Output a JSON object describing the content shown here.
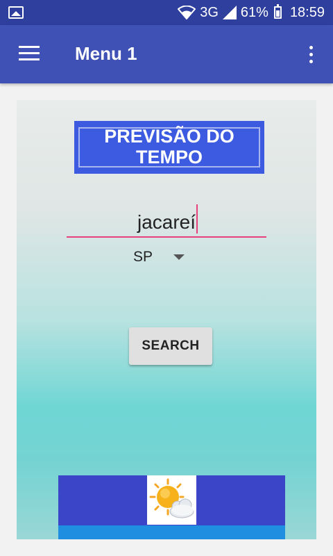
{
  "status_bar": {
    "network": "3G",
    "battery": "61%",
    "time": "18:59"
  },
  "app_bar": {
    "title": "Menu 1"
  },
  "main": {
    "heading": "PREVISÃO DO TEMPO",
    "city_input": {
      "value": "jacareí"
    },
    "state_select": {
      "selected": "SP"
    },
    "search_label": "SEARCH",
    "weather_icon": "sun-behind-cloud-icon"
  },
  "colors": {
    "app_bar": "#3f51b5",
    "status_bar": "#2f3f9e",
    "accent": "#e8407a",
    "heading_box": "#3d5be0",
    "weather_panel": "#3a45c8",
    "weather_strip": "#1f8ee0"
  }
}
